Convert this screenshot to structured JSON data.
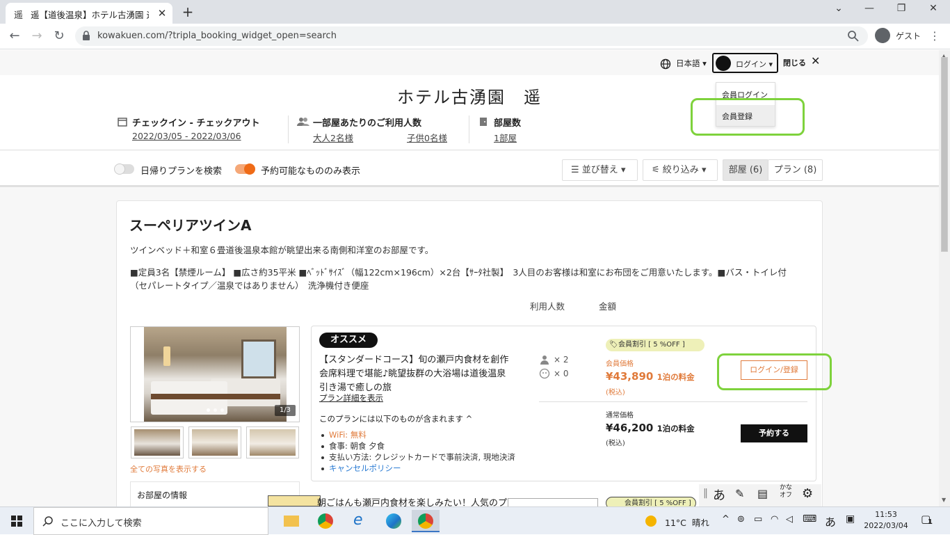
{
  "browser": {
    "tab_title": "遥【道後温泉】ホテル古湧園 遥",
    "tab_favicon": "遥",
    "url": "kowakuen.com/?tripla_booking_widget_open=search",
    "profile_label": "ゲスト"
  },
  "topbar": {
    "language": "日本語",
    "login": "ログイン",
    "close": "閉じる"
  },
  "dropdown": {
    "items": [
      "会員ログイン",
      "会員登録"
    ]
  },
  "header": {
    "hotel_name": "ホテル古湧園　遥",
    "checkin_label": "チェックイン - チェックアウト",
    "checkin_value": "2022/03/05 - 2022/03/06",
    "guests_label": "一部屋あたりのご利用人数",
    "adults": "大人2名様",
    "children": "子供0名様",
    "rooms_label": "部屋数",
    "rooms_value": "1部屋"
  },
  "filters": {
    "dayplan_label": "日帰りプランを検索",
    "dayplan_on": false,
    "available_label": "予約可能なもののみ表示",
    "available_on": true,
    "sort": "並び替え",
    "filter": "絞り込み",
    "tab_rooms": "部屋 (6)",
    "tab_plans": "プラン (8)"
  },
  "room": {
    "name": "スーペリアツインA",
    "desc1": "ツインベッド＋和室６畳道後温泉本館が眺望出来る南側和洋室のお部屋です。",
    "desc2": "■定員3名【禁煙ルーム】 ■広さ約35平米 ■ﾍﾞｯﾄﾞｻｲｽﾞ（幅122cm×196cm）×2台【ｻｰﾀ社製】　3人目のお客様は和室にお布団をご用意いたします。■バス・トイレ付",
    "desc3": "（セパレートタイプ／温泉ではありません）　洗浄機付き便座",
    "col_guests": "利用人数",
    "col_price": "金額",
    "photo_counter": "1/3",
    "all_photos": "全ての写真を表示する",
    "room_info": "お部屋の情報"
  },
  "plan": {
    "badge": "オススメ",
    "title_lines": [
      "【スタンダードコース】旬の瀬戸内食材を創作",
      "会席料理で堪能♪眺望抜群の大浴場は道後温泉",
      "引き湯で癒しの旅"
    ],
    "details_link": "プラン詳細を表示",
    "includes_heading": "このプランには以下のものが含まれます",
    "includes": [
      {
        "label": "WiFi: 無料",
        "color": "#e07a3a"
      },
      {
        "label": "食事: 朝食 夕食",
        "color": "#333333"
      },
      {
        "label": "支払い方法: クレジットカードで事前決済, 現地決済",
        "color": "#333333"
      },
      {
        "label": "キャンセルポリシー",
        "color": "#2a7bd3"
      }
    ],
    "adults_count": "× 2",
    "children_count": "× 0",
    "member_discount": "会員割引 [ 5 %OFF ]",
    "member_price_label": "会員価格",
    "member_price": "¥43,890",
    "per_night": "1泊の料金",
    "tax_incl": "(税込)",
    "regular_price_label": "通常価格",
    "regular_price": "¥46,200",
    "login_register": "ログイン/登録",
    "reserve": "予約する"
  },
  "next_plan": {
    "title": "朝ごはんも瀬戸内食材を楽しみたい！人気のプ",
    "member_discount": "会員割引 [ 5 %OFF ]"
  },
  "taskbar": {
    "search_placeholder": "ここに入力して検索",
    "weather": "11°C  晴れ",
    "ime": "あ",
    "time": "11:53",
    "date": "2022/03/04",
    "notifications": "1"
  },
  "ime_bar": {
    "mode": "あ",
    "kana": "かな\nオフ"
  },
  "colors": {
    "accent_orange": "#e07a3a",
    "highlight_green": "#7ed23c",
    "discount_yellow": "#eef0b8"
  }
}
